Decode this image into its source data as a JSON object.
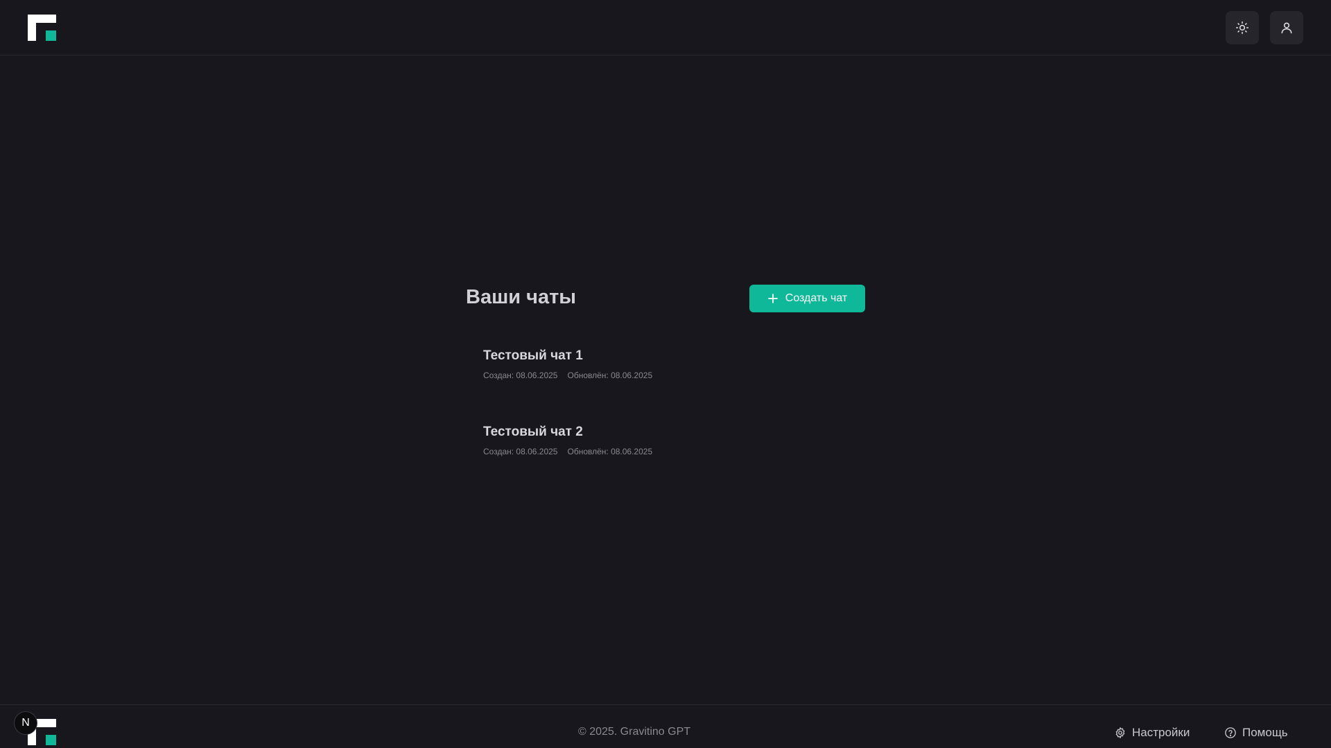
{
  "header": {
    "logo": "gravitino-logo",
    "theme_button_icon": "sun-icon",
    "user_button_icon": "user-icon"
  },
  "main": {
    "title": "Ваши чаты",
    "create_button": {
      "icon": "plus-icon",
      "label": "Создать чат"
    },
    "chats": [
      {
        "title": "Тестовый чат 1",
        "created": "Создан: 08.06.2025",
        "updated": "Обновлён: 08.06.2025"
      },
      {
        "title": "Тестовый чат 2",
        "created": "Создан: 08.06.2025",
        "updated": "Обновлён: 08.06.2025"
      }
    ]
  },
  "footer": {
    "badge": "N",
    "copyright": "© 2025. Gravitino GPT",
    "settings_label": "Настройки",
    "settings_icon": "gear-icon",
    "help_label": "Помощь",
    "help_icon": "question-circle-icon"
  },
  "colors": {
    "background": "#18171d",
    "accent": "#10b89a",
    "button_bg": "#26252c",
    "border": "#2a2930"
  }
}
